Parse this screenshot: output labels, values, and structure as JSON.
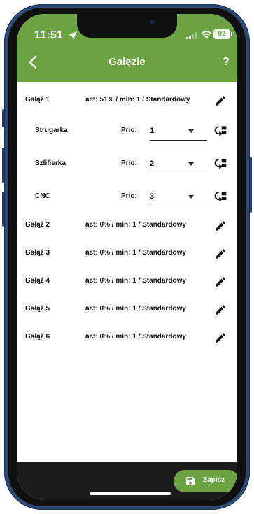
{
  "status_bar": {
    "time": "11:51",
    "battery": "92"
  },
  "header": {
    "back_icon": "chevron-left-icon",
    "title": "Gałęzie",
    "help": "?"
  },
  "branches": [
    {
      "name": "Gałąź 1",
      "status": "act: 51% / min: 1 / Standardowy"
    },
    {
      "name": "Gałąź 2",
      "status": "act: 0% / min: 1 / Standardowy"
    },
    {
      "name": "Gałąź 3",
      "status": "act: 0% / min: 1 / Standardowy"
    },
    {
      "name": "Gałąź 4",
      "status": "act: 0% / min: 1 / Standardowy"
    },
    {
      "name": "Gałąź 5",
      "status": "act: 0% / min: 1 / Standardowy"
    },
    {
      "name": "Gałąź 6",
      "status": "act: 0% / min: 1 / Standardowy"
    }
  ],
  "machines": [
    {
      "name": "Strugarka",
      "prio_label": "Prio:",
      "prio": "1"
    },
    {
      "name": "Szlifierka",
      "prio_label": "Prio:",
      "prio": "2"
    },
    {
      "name": "CNC",
      "prio_label": "Prio:",
      "prio": "3"
    }
  ],
  "footer": {
    "save_label": "Zapisz",
    "save_icon": "floppy-disk-icon"
  },
  "colors": {
    "accent": "#6ba343",
    "bottom_bar": "#1c1c1c"
  }
}
